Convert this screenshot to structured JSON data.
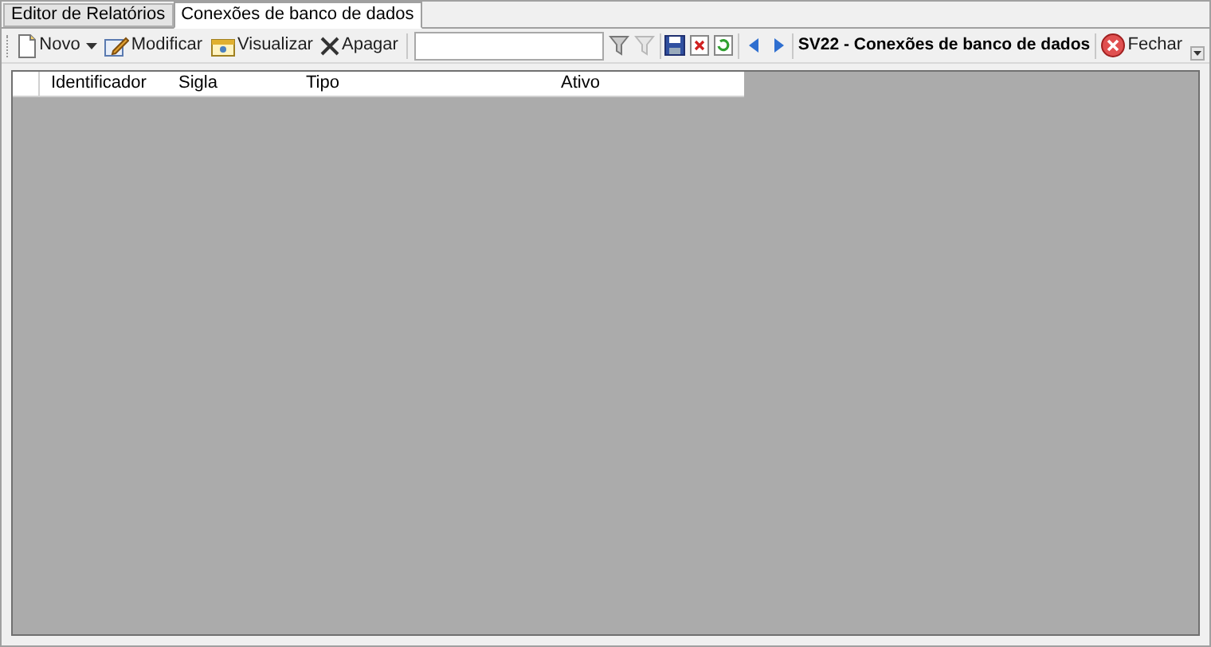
{
  "tabs": [
    {
      "label": "Editor de Relatórios",
      "selected": false
    },
    {
      "label": "Conexões de banco de dados",
      "selected": true
    }
  ],
  "toolbar": {
    "buttons": [
      {
        "label": "Novo",
        "kind": "new",
        "dropdown": true
      },
      {
        "label": "Modificar",
        "kind": "edit",
        "dropdown": false
      },
      {
        "label": "Visualizar",
        "kind": "view",
        "dropdown": false
      },
      {
        "label": "Apagar",
        "kind": "delete",
        "dropdown": false
      }
    ],
    "title": "SV22 - Conexões de banco de dados",
    "close": "Fechar"
  },
  "table": {
    "columns": [
      "Identificador",
      "Sigla",
      "Tipo",
      "Ativo"
    ]
  }
}
